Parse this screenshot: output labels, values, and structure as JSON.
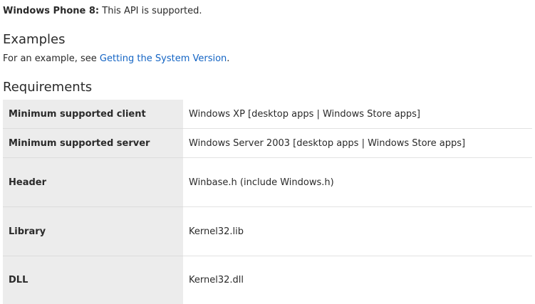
{
  "support": {
    "platform": "Windows Phone 8:",
    "text": " This API is supported."
  },
  "examples": {
    "heading": "Examples",
    "prefix": "For an example, see ",
    "link_text": "Getting the System Version",
    "suffix": "."
  },
  "requirements": {
    "heading": "Requirements",
    "rows": [
      {
        "label": "Minimum supported client",
        "value": "Windows XP [desktop apps | Windows Store apps]"
      },
      {
        "label": "Minimum supported server",
        "value": "Windows Server 2003 [desktop apps | Windows Store apps]"
      },
      {
        "label": "Header",
        "value": "Winbase.h (include Windows.h)"
      },
      {
        "label": "Library",
        "value": "Kernel32.lib"
      },
      {
        "label": "DLL",
        "value": "Kernel32.dll"
      }
    ]
  },
  "colors": {
    "link": "#1364c4",
    "label_background": "#ececec"
  }
}
